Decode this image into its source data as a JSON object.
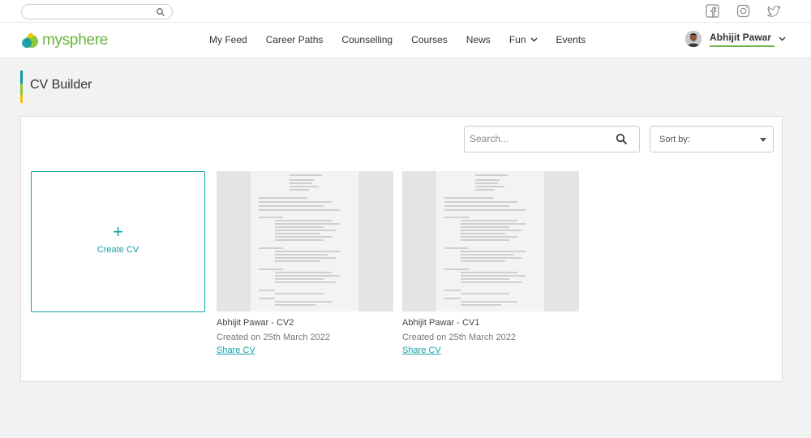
{
  "topbar": {
    "search_placeholder": "",
    "social": [
      "facebook-icon",
      "instagram-icon",
      "twitter-icon"
    ]
  },
  "brand": {
    "name": "mysphere",
    "color": "#6cb33f"
  },
  "nav": {
    "links": [
      "My Feed",
      "Career Paths",
      "Counselling",
      "Courses",
      "News",
      "Fun",
      "Events"
    ]
  },
  "user": {
    "name": "Abhijit Pawar"
  },
  "page": {
    "title": "CV Builder"
  },
  "toolbar": {
    "search_placeholder": "Search...",
    "sort_label": "Sort by:"
  },
  "create": {
    "plus": "+",
    "label": "Create CV"
  },
  "cvs": [
    {
      "title": "Abhijit Pawar - CV2",
      "created": "Created on 25th March 2022",
      "share": "Share CV"
    },
    {
      "title": "Abhijit Pawar - CV1",
      "created": "Created on 25th March 2022",
      "share": "Share CV"
    }
  ],
  "colors": {
    "accent": "#13a1a8",
    "brand_green": "#6cb33f",
    "yellow": "#f5c400"
  }
}
